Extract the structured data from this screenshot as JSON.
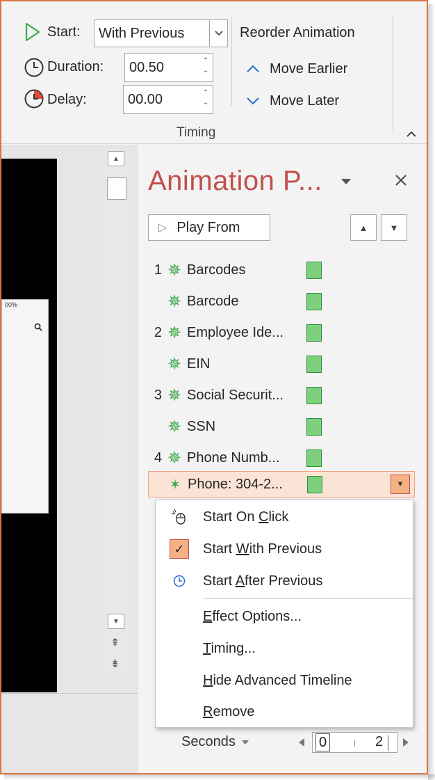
{
  "ribbon": {
    "start_label": "Start:",
    "start_value": "With Previous",
    "duration_label": "Duration:",
    "duration_value": "00.50",
    "delay_label": "Delay:",
    "delay_value": "00.00",
    "reorder_title": "Reorder Animation",
    "move_earlier": "Move Earlier",
    "move_later": "Move Later",
    "group_label": "Timing"
  },
  "pane": {
    "title": "Animation P...",
    "play_from": "Play From",
    "items": [
      {
        "num": "1",
        "label": "Barcodes"
      },
      {
        "num": "",
        "label": "Barcode"
      },
      {
        "num": "2",
        "label": "Employee Ide..."
      },
      {
        "num": "",
        "label": "EIN"
      },
      {
        "num": "3",
        "label": "Social Securit..."
      },
      {
        "num": "",
        "label": "SSN"
      },
      {
        "num": "4",
        "label": "Phone Numb..."
      },
      {
        "num": "",
        "label": "Phone: 304-2..."
      }
    ]
  },
  "menu": {
    "start_on_click": {
      "pre": "Start On ",
      "u": "C",
      "post": "lick"
    },
    "start_with_previous": {
      "pre": "Start ",
      "u": "W",
      "post": "ith Previous"
    },
    "start_after_previous": {
      "pre": "Start ",
      "u": "A",
      "post": "fter Previous"
    },
    "effect_options": {
      "pre": "",
      "u": "E",
      "post": "ffect Options..."
    },
    "timing": {
      "pre": "",
      "u": "T",
      "post": "iming..."
    },
    "hide_timeline": {
      "pre": "",
      "u": "H",
      "post": "ide Advanced Timeline"
    },
    "remove": {
      "pre": "",
      "u": "R",
      "post": "emove"
    }
  },
  "timeline": {
    "seconds_label": "Seconds",
    "start_value": "0",
    "end_value": "2"
  },
  "slide": {
    "status_text": "00%"
  },
  "colors": {
    "accent": "#c0504d",
    "frame": "#d9743f",
    "selection": "#fbe3d6",
    "effect_green": "#3ea94a"
  }
}
